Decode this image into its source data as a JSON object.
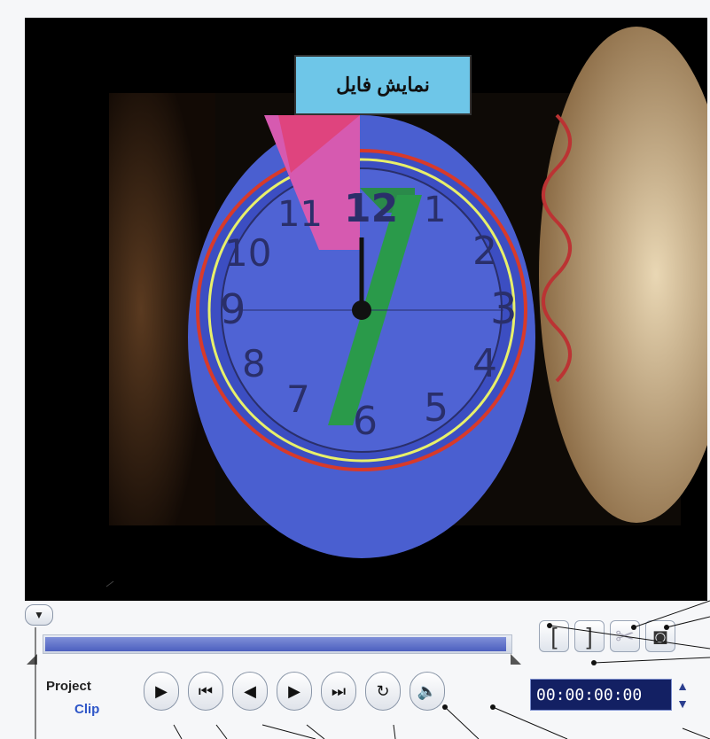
{
  "preview": {
    "title": "نمایش فایل"
  },
  "labels": {
    "project": "Project",
    "clip": "Clip"
  },
  "timecode": "00:00:00:00",
  "colors": {
    "title_bg": "#6ec6e8",
    "timecode_bg": "#132063",
    "track_fill": "#4c5fbf",
    "clip_label": "#2e56c8"
  },
  "progress_fraction": 0.0,
  "icons": {
    "scrubber": "chevron-down-icon",
    "mark_in": "bracket-left-icon",
    "mark_out": "bracket-right-icon",
    "cut": "scissors-icon",
    "snapshot": "camera-icon",
    "play": "play-icon",
    "start": "skip-start-icon",
    "prev": "prev-frame-icon",
    "next": "next-frame-icon",
    "end": "skip-end-icon",
    "repeat": "repeat-icon",
    "volume": "speaker-icon"
  }
}
